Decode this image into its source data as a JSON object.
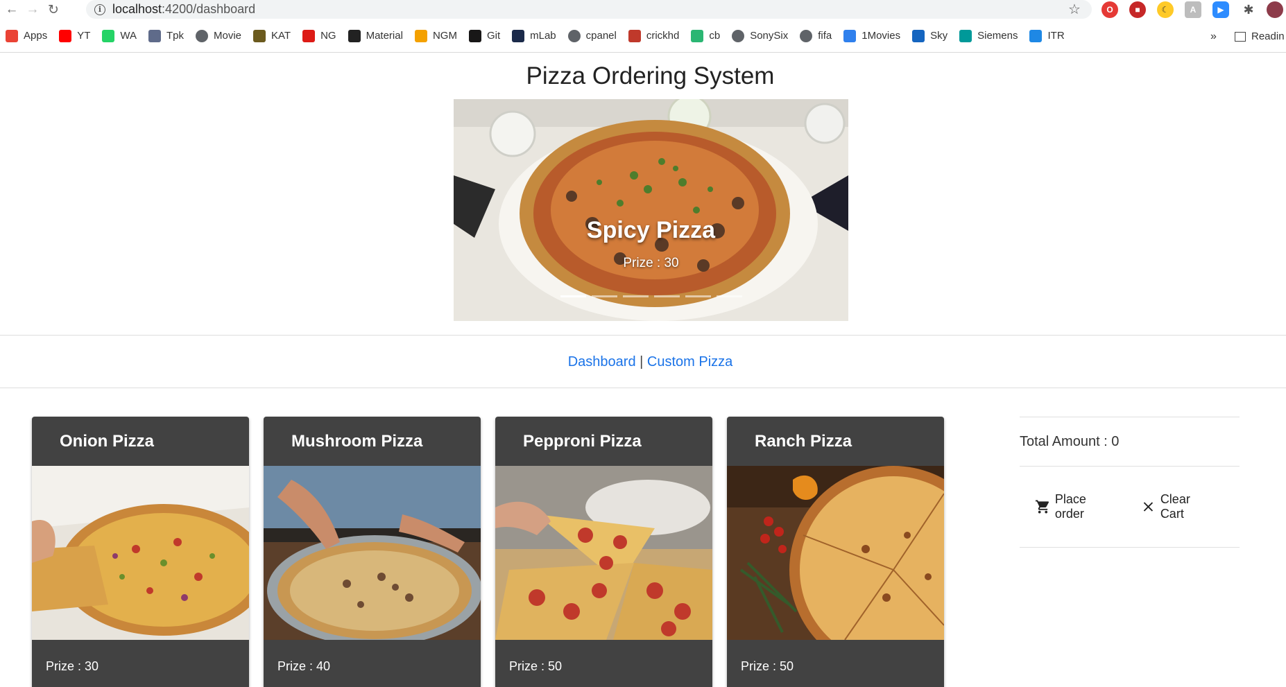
{
  "browser": {
    "url_host": "localhost",
    "url_rest": ":4200/dashboard",
    "bookmarks": [
      {
        "label": "Apps",
        "icon": "apps-grid-icon",
        "color": "#ea4335"
      },
      {
        "label": "YT",
        "icon": "youtube-icon",
        "color": "#ff0000"
      },
      {
        "label": "WA",
        "icon": "whatsapp-icon",
        "color": "#25d366"
      },
      {
        "label": "Tpk",
        "icon": "play-circle-icon",
        "color": "#5f6b8a"
      },
      {
        "label": "Movie",
        "icon": "globe-icon",
        "color": "#5f6368"
      },
      {
        "label": "KAT",
        "icon": "kat-icon",
        "color": "#6b5a1e"
      },
      {
        "label": "NG",
        "icon": "angular-icon",
        "color": "#dd1b16"
      },
      {
        "label": "Material",
        "icon": "material-icon",
        "color": "#222222"
      },
      {
        "label": "NGM",
        "icon": "ngm-icon",
        "color": "#f4a100"
      },
      {
        "label": "Git",
        "icon": "github-icon",
        "color": "#181717"
      },
      {
        "label": "mLab",
        "icon": "mlab-icon",
        "color": "#1b2a4a"
      },
      {
        "label": "cpanel",
        "icon": "globe-icon",
        "color": "#5f6368"
      },
      {
        "label": "crickhd",
        "icon": "cricket-icon",
        "color": "#c0392b"
      },
      {
        "label": "cb",
        "icon": "cb-icon",
        "color": "#2bb673"
      },
      {
        "label": "SonySix",
        "icon": "globe-icon",
        "color": "#5f6368"
      },
      {
        "label": "fifa",
        "icon": "globe-icon",
        "color": "#5f6368"
      },
      {
        "label": "1Movies",
        "icon": "1movies-icon",
        "color": "#2f80ed"
      },
      {
        "label": "Sky",
        "icon": "sky-icon",
        "color": "#1565c0"
      },
      {
        "label": "Siemens",
        "icon": "siemens-icon",
        "color": "#009999"
      },
      {
        "label": "ITR",
        "icon": "ie-icon",
        "color": "#1e88e5"
      }
    ],
    "more": "»",
    "reading_list": "Readin"
  },
  "page": {
    "title": "Pizza Ordering System",
    "carousel": {
      "title": "Spicy Pizza",
      "subtitle": "Prize : 30",
      "indicator_count": 6,
      "active_index": 0
    },
    "menu": {
      "dashboard": "Dashboard",
      "separator": " | ",
      "custom": "Custom Pizza"
    },
    "cards": [
      {
        "name": "Onion Pizza",
        "price": "Prize : 30"
      },
      {
        "name": "Mushroom Pizza",
        "price": "Prize : 40"
      },
      {
        "name": "Pepproni Pizza",
        "price": "Prize : 50"
      },
      {
        "name": "Ranch Pizza",
        "price": "Prize : 50"
      }
    ],
    "summary": {
      "total": "Total Amount : 0",
      "place_order": "Place order",
      "clear_cart": "Clear Cart"
    }
  },
  "colors": {
    "card_bg": "#424242",
    "link": "#1a73e8"
  }
}
